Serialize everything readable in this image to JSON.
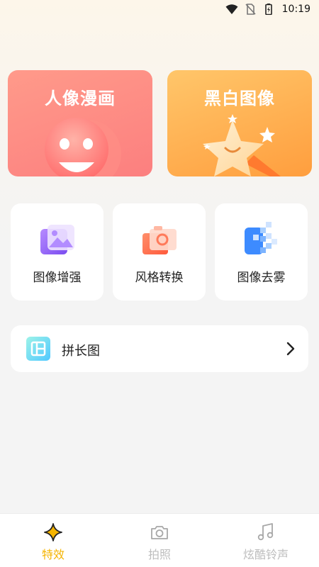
{
  "status_bar": {
    "time": "10:19",
    "icons": [
      "wifi-icon",
      "no-sim-icon",
      "battery-charging-icon"
    ]
  },
  "feature_cards": [
    {
      "title": "人像漫画",
      "icon": "smiley-face-icon",
      "color": "#fc7f7f"
    },
    {
      "title": "黑白图像",
      "icon": "star-wand-icon",
      "color": "#ffa544"
    }
  ],
  "tools": [
    {
      "label": "图像增强",
      "icon": "image-enhance-icon"
    },
    {
      "label": "风格转换",
      "icon": "camera-style-icon"
    },
    {
      "label": "图像去雾",
      "icon": "dehaze-pixel-icon"
    }
  ],
  "long_image": {
    "label": "拼长图",
    "icon": "layout-grid-icon"
  },
  "bottom_nav": [
    {
      "label": "特效",
      "icon": "sparkle-icon",
      "active": true
    },
    {
      "label": "拍照",
      "icon": "camera-icon",
      "active": false
    },
    {
      "label": "炫酷铃声",
      "icon": "music-note-icon",
      "active": false
    }
  ],
  "colors": {
    "accent": "#f5b400",
    "inactive": "#bdbdbd"
  }
}
